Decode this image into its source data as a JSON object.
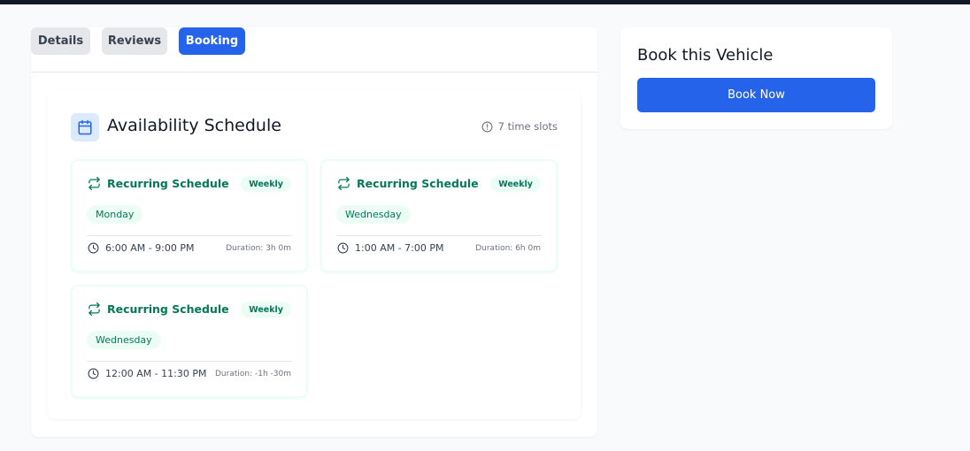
{
  "tabs": [
    {
      "label": "Details",
      "active": false
    },
    {
      "label": "Reviews",
      "active": false
    },
    {
      "label": "Booking",
      "active": true
    }
  ],
  "schedule": {
    "title": "Availability Schedule",
    "slot_count_label": "7 time slots",
    "icons": {
      "header": "calendar-icon",
      "info": "info-icon",
      "recurring": "repeat-icon",
      "time": "clock-icon"
    },
    "cards": [
      {
        "title": "Recurring Schedule",
        "frequency": "Weekly",
        "day": "Monday",
        "time": "6:00 AM - 9:00 PM",
        "duration": "Duration: 3h 0m"
      },
      {
        "title": "Recurring Schedule",
        "frequency": "Weekly",
        "day": "Wednesday",
        "time": "1:00 AM - 7:00 PM",
        "duration": "Duration: 6h 0m"
      },
      {
        "title": "Recurring Schedule",
        "frequency": "Weekly",
        "day": "Wednesday",
        "time": "12:00 AM - 11:30 PM",
        "duration": "Duration: -1h -30m"
      }
    ]
  },
  "booking": {
    "title": "Book this Vehicle",
    "button_label": "Book Now"
  },
  "colors": {
    "primary": "#2563eb",
    "accent_green": "#047857",
    "green_tint": "#ecfdf5",
    "tab_inactive": "#e5e7eb"
  }
}
